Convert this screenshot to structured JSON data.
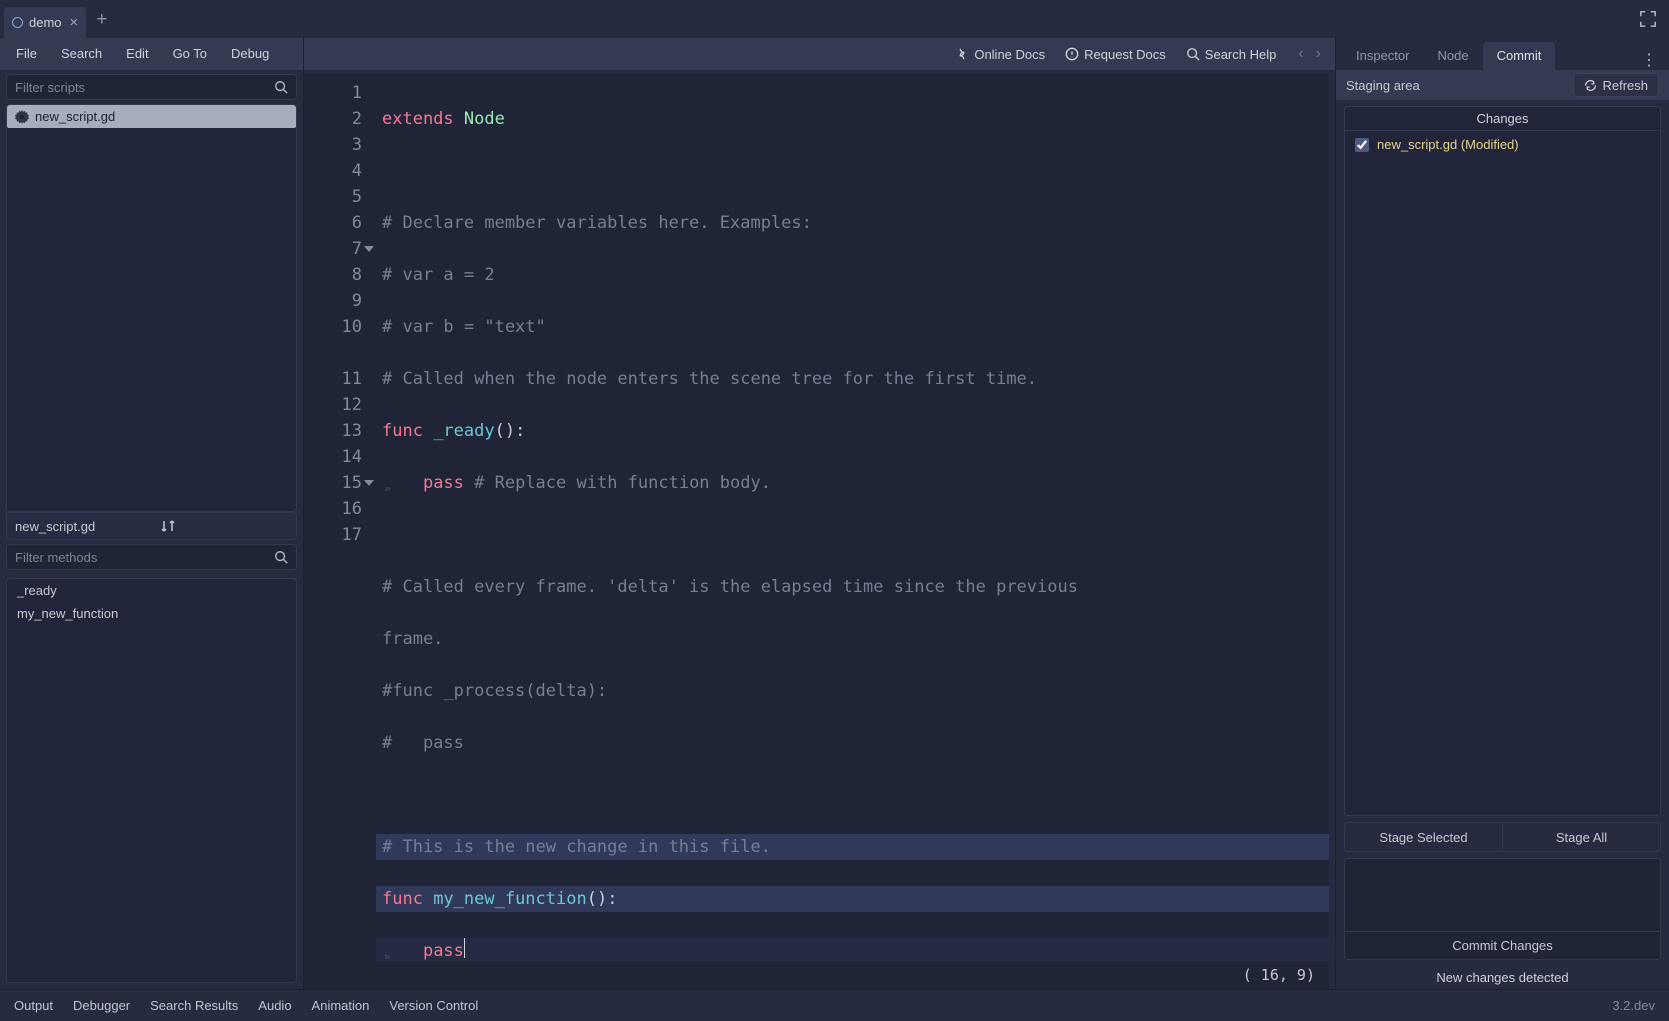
{
  "scene_tab": {
    "label": "demo"
  },
  "menu": {
    "file": "File",
    "search": "Search",
    "edit": "Edit",
    "goto": "Go To",
    "debug": "Debug"
  },
  "toolbar": {
    "online_docs": "Online Docs",
    "request_docs": "Request Docs",
    "search_help": "Search Help"
  },
  "scripts_filter_placeholder": "Filter scripts",
  "script_item": "new_script.gd",
  "script_current": "new_script.gd",
  "methods_filter_placeholder": "Filter methods",
  "methods": {
    "m0": "_ready",
    "m1": "my_new_function"
  },
  "code": {
    "l1a": "extends",
    "l1b": " Node",
    "l3": "# Declare member variables here. Examples:",
    "l4": "# var a = 2",
    "l5": "# var b = \"text\"",
    "l6": "# Called when the node enters the scene tree for the first time.",
    "l7a": "func",
    "l7b": " _ready",
    "l7c": "():",
    "l8a": "pass",
    "l8b": " # Replace with function body.",
    "l10a": "# Called every frame. 'delta' is the elapsed time since the previous",
    "l10b": "frame.",
    "l11": "#func _process(delta):",
    "l12": "#   pass",
    "l14": "# This is the new change in this file.",
    "l15a": "func",
    "l15b": " my_new_function",
    "l15c": "():",
    "l16": "pass"
  },
  "line_numbers": [
    "1",
    "2",
    "3",
    "4",
    "5",
    "6",
    "7",
    "8",
    "9",
    "10",
    "10",
    "11",
    "12",
    "13",
    "14",
    "15",
    "16",
    "17"
  ],
  "cursor_status": "(  16,   9)",
  "inspector_tabs": {
    "inspector": "Inspector",
    "node": "Node",
    "commit": "Commit"
  },
  "staging_label": "Staging area",
  "refresh_label": "Refresh",
  "changes_label": "Changes",
  "change_file": "new_script.gd (Modified)",
  "stage_selected": "Stage Selected",
  "stage_all": "Stage All",
  "commit_changes": "Commit Changes",
  "new_changes": "New changes detected",
  "bottom": {
    "output": "Output",
    "debugger": "Debugger",
    "search_results": "Search Results",
    "audio": "Audio",
    "animation": "Animation",
    "vc": "Version Control"
  },
  "version": "3.2.dev"
}
